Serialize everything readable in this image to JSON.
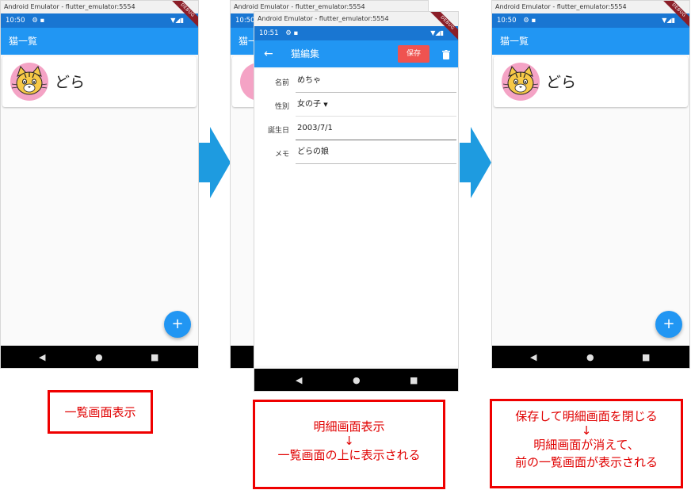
{
  "colors": {
    "appbar": "#2196f3",
    "statusbar": "#1976d2",
    "caption_red": "#e00000",
    "arrow": "#1e9be0",
    "save_button": "#ef5350",
    "avatar_bg": "#f4a3c5"
  },
  "screen1": {
    "window_title": "Android Emulator - flutter_emulator:5554",
    "status_time": "10:50",
    "debug_banner": "DEBUG",
    "appbar_title": "猫一覧",
    "list_item_name": "どら",
    "fab_icon": "+",
    "caption": "一覧画面表示"
  },
  "screen2": {
    "window_title": "Android Emulator - flutter_emulator:5554",
    "status_time": "10:51",
    "debug_banner": "DEBUG",
    "appbar_title": "猫編集",
    "back_icon": "←",
    "save_label": "保存",
    "fields": {
      "name_label": "名前",
      "name_value": "めちゃ",
      "gender_label": "性別",
      "gender_value": "女の子",
      "birthday_label": "誕生日",
      "birthday_value": "2003/7/1",
      "memo_label": "メモ",
      "memo_value": "どらの娘"
    },
    "caption_line1": "明細画面表示",
    "caption_arrow": "↓",
    "caption_line2": "一覧画面の上に表示される"
  },
  "screen3": {
    "window_title": "Android Emulator - flutter_emulator:5554",
    "status_time": "10:50",
    "debug_banner": "DEBUG",
    "appbar_title": "猫一覧",
    "list_item_name": "どら",
    "fab_icon": "+",
    "caption_line1": "保存して明細画面を閉じる",
    "caption_arrow": "↓",
    "caption_line2": "明細画面が消えて、",
    "caption_line3": "前の一覧画面が表示される"
  }
}
